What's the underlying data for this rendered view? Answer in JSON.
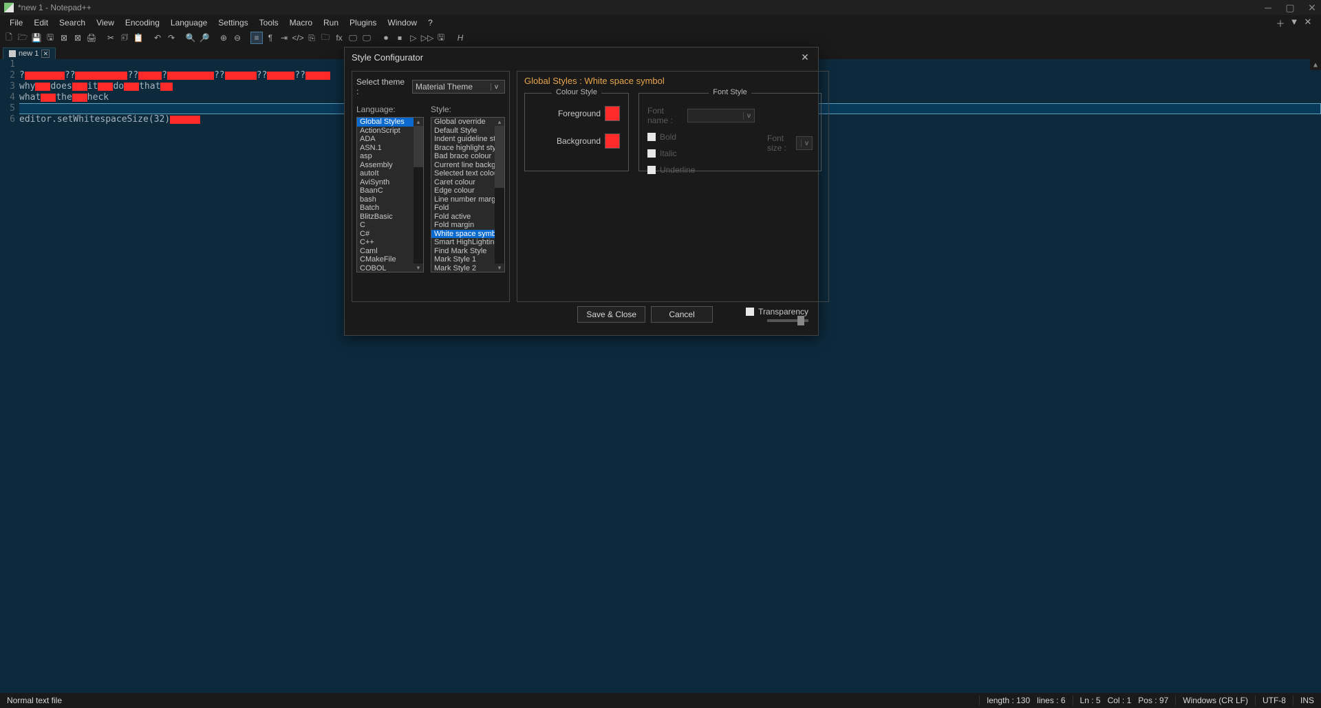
{
  "title": "*new 1 - Notepad++",
  "menu": [
    "File",
    "Edit",
    "Search",
    "View",
    "Encoding",
    "Language",
    "Settings",
    "Tools",
    "Macro",
    "Run",
    "Plugins",
    "Window",
    "?"
  ],
  "menu_right_icons": [
    "plus-icon",
    "triangledown-icon",
    "close-icon"
  ],
  "toolbar_icons": [
    "new-file",
    "open-file",
    "save",
    "save-all",
    "close",
    "close-all",
    "print",
    "",
    "cut",
    "copy",
    "paste",
    "",
    "undo",
    "redo",
    "",
    "find",
    "replace",
    "",
    "zoom-in",
    "zoom-out",
    "",
    "wrap",
    "show-all",
    "indent-guide",
    "code",
    "function-list",
    "folder",
    "fx",
    "monitor",
    "monitor-multi",
    "",
    "record",
    "stop",
    "play",
    "play-loop",
    "save-macro",
    "",
    "help"
  ],
  "tab": {
    "name": "new 1"
  },
  "editor": {
    "lines": [
      1,
      2,
      3,
      4,
      5,
      6
    ],
    "code3": "why does it do that",
    "code4": "what the heck",
    "code6": "editor.setWhitespaceSize(32)"
  },
  "status": {
    "filetype": "Normal text file",
    "length": "length : 130",
    "lines": "lines : 6",
    "ln": "Ln : 5",
    "col": "Col : 1",
    "pos": "Pos : 97",
    "eol": "Windows (CR LF)",
    "encoding": "UTF-8",
    "ins": "INS"
  },
  "dialog": {
    "title": "Style Configurator",
    "select_theme_label": "Select theme :",
    "theme": "Material Theme",
    "language_label": "Language:",
    "style_label": "Style:",
    "languages": [
      "Global Styles",
      "ActionScript",
      "ADA",
      "ASN.1",
      "asp",
      "Assembly",
      "autoIt",
      "AviSynth",
      "BaanC",
      "bash",
      "Batch",
      "BlitzBasic",
      "C",
      "C#",
      "C++",
      "Caml",
      "CMakeFile",
      "COBOL"
    ],
    "language_selected": "Global Styles",
    "styles": [
      "Global override",
      "Default Style",
      "Indent guideline style",
      "Brace highlight style",
      "Bad brace colour",
      "Current line background",
      "Selected text colour",
      "Caret colour",
      "Edge colour",
      "Line number margin",
      "Fold",
      "Fold active",
      "Fold margin",
      "White space symbol",
      "Smart HighLighting",
      "Find Mark Style",
      "Mark Style 1",
      "Mark Style 2"
    ],
    "style_selected": "White space symbol",
    "heading": "Global Styles : White space symbol",
    "colour_legend": "Colour Style",
    "fg_label": "Foreground",
    "bg_label": "Background",
    "font_legend": "Font Style",
    "font_name_label": "Font name :",
    "bold": "Bold",
    "italic": "Italic",
    "underline": "Underline",
    "font_size_label": "Font size :",
    "save": "Save & Close",
    "cancel": "Cancel",
    "transparency": "Transparency",
    "fg_color": "#ff2a2a",
    "bg_color": "#ff2a2a"
  }
}
